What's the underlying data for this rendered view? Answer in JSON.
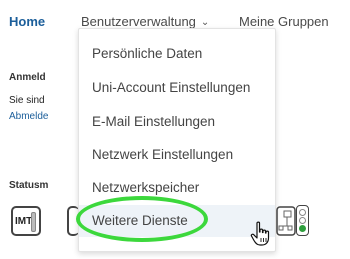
{
  "nav": {
    "home": "Home",
    "benutzerverwaltung": "Benutzerverwaltung",
    "meine_gruppen": "Meine Gruppen"
  },
  "background": {
    "heading": "Anmeld",
    "line": "Sie sind",
    "link": "Abmelde",
    "status_heading": "Statusm",
    "badge_text": "IMT:"
  },
  "dropdown": {
    "items": [
      {
        "label": "Persönliche Daten"
      },
      {
        "label": "Uni-Account Einstellungen"
      },
      {
        "label": "E-Mail Einstellungen"
      },
      {
        "label": "Netzwerk Einstellungen"
      },
      {
        "label": "Netzwerkspeicher"
      },
      {
        "label": "Weitere Dienste",
        "active": true
      }
    ]
  },
  "colors": {
    "link_blue": "#1b5e9a",
    "highlight_green": "#3cd83c",
    "hover_bg": "#eef3f8"
  },
  "icons": [
    "chevron-down-icon",
    "hand-pointer-icon",
    "traffic-light-icon",
    "imt-status-icon",
    "network-icon"
  ]
}
